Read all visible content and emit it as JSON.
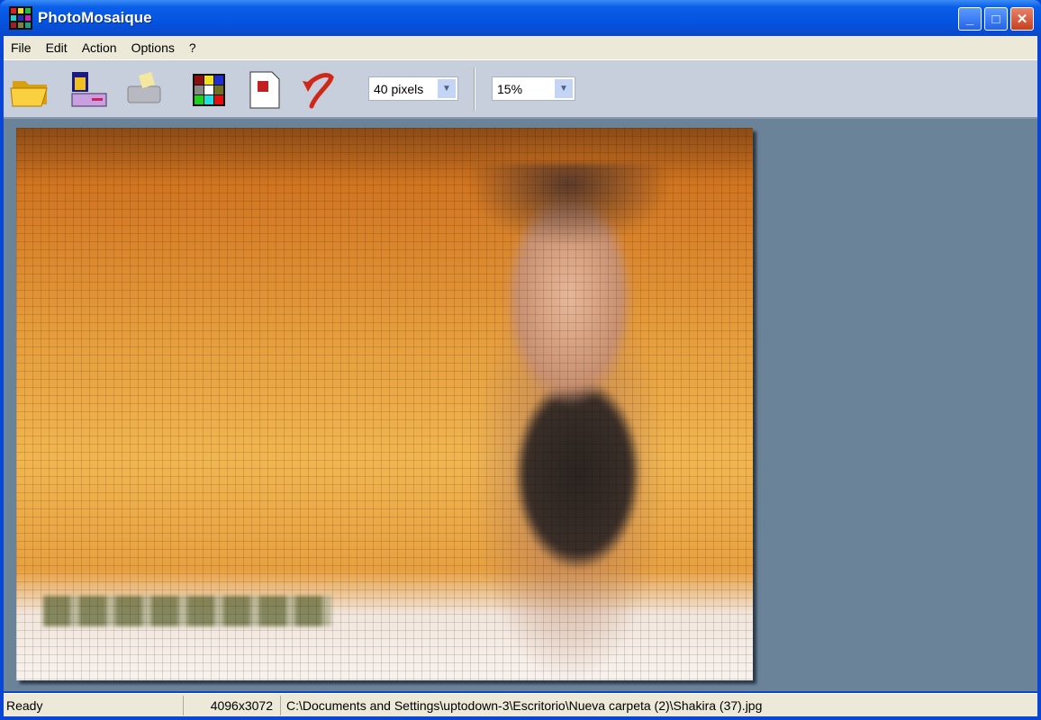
{
  "window": {
    "title": "PhotoMosaique",
    "minimize": "_",
    "maximize": "□",
    "close": "✕"
  },
  "menu": [
    "File",
    "Edit",
    "Action",
    "Options",
    "?"
  ],
  "toolbar": {
    "icons": [
      "open-folder-icon",
      "save-icon",
      "print-icon",
      "mosaic-grid-icon",
      "export-document-icon",
      "undo-icon"
    ],
    "tile_size": "40 pixels",
    "zoom": "15%"
  },
  "status": {
    "state": "Ready",
    "dimensions": "4096x3072",
    "path": "C:\\Documents and Settings\\uptodown-3\\Escritorio\\Nueva carpeta (2)\\Shakira (37).jpg"
  },
  "colors": {
    "titlebar": "#0454e0",
    "workspace": "#6b8399",
    "toolbar": "#c6cfdb"
  }
}
